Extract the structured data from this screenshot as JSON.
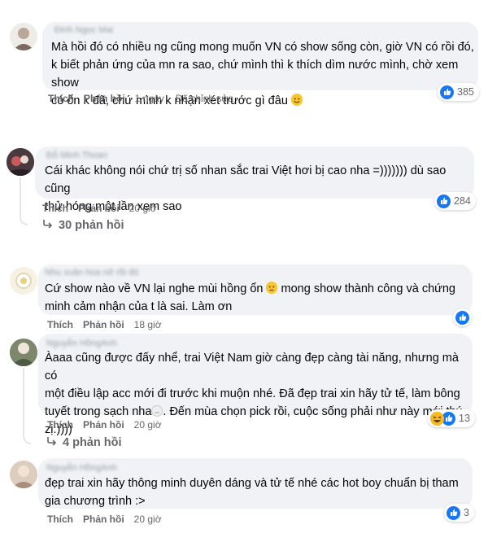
{
  "comments": [
    {
      "name": "Đinh Ngọc Mai",
      "lines": [
        "Mà hồi đó có nhiều ng cũng mong muốn VN có show sống còn, giờ VN có rồi đó,",
        "k biết phản ứng của mn ra sao, chứ mình thì k thích dìm nước mình, chờ xem show",
        "có ổn k đã, chứ mình k nhận xét trước gì đâu"
      ],
      "like_label": "Thích",
      "reply_label": "Phản hồi",
      "time": "1 ngày",
      "edited": "Đã chỉnh sửa",
      "reaction_count": "385"
    },
    {
      "name": "Đỗ Minh Thoan",
      "lines": [
        "Cái khác không nói chứ trị số nhan sắc trai Việt hơi bị cao nha =))))))) dù sao cũng",
        "thử hóng một lần xem sao"
      ],
      "like_label": "Thích",
      "reply_label": "Phản hồi",
      "time": "20 giờ",
      "reaction_count": "284",
      "replies": "30 phản hồi"
    },
    {
      "name": "Nhu xuân hoa nở rồi đó",
      "lines": [
        "Cứ show nào về VN lại nghe mùi hồng ổn",
        "mong show thành công và chứng",
        "minh cảm nhận của t là sai. Làm ơn"
      ],
      "like_label": "Thích",
      "reply_label": "Phản hồi",
      "time": "18 giờ"
    },
    {
      "name": "Nguyễn HồngAnh",
      "lines": [
        "Àaaa cũng được đấy nhể, trai Việt Nam giờ càng đẹp càng tài năng, nhưng mà có",
        "một điều lập acc mới đi trước khi muộn nhé. Đã đẹp trai xin hãy tử tế, làm bông",
        "tuyết trong sạch nha",
        ". Đến mùa chọn pick rồi, cuộc sống phải như này mới thú",
        "zị:))))"
      ],
      "like_label": "Thích",
      "reply_label": "Phản hồi",
      "time": "20 giờ",
      "reaction_count": "13",
      "replies": "4 phản hồi"
    },
    {
      "name": "Nguyễn HồngAnh",
      "lines": [
        "đẹp trai xin hãy thông minh duyên dáng và tử tế nhé các hot boy chuẩn bị tham",
        "gia chương trình :>"
      ],
      "like_label": "Thích",
      "reply_label": "Phản hồi",
      "time": "20 giờ",
      "reaction_count": "3"
    }
  ],
  "icons": {
    "like": "like-icon",
    "haha": "haha-icon",
    "reply_arrow": "reply-arrow-icon",
    "emoji": "smile-emoji-icon"
  },
  "colors": {
    "bubble": "#f0f2f5",
    "like_blue": "#1877f2",
    "meta_gray": "#65676b"
  }
}
